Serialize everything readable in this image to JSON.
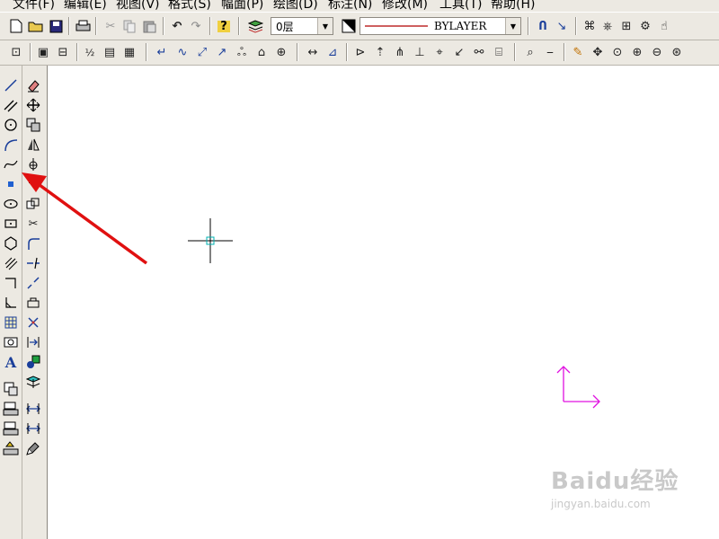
{
  "menu": [
    {
      "label": "文件(F)"
    },
    {
      "label": "编辑(E)"
    },
    {
      "label": "视图(V)"
    },
    {
      "label": "格式(S)"
    },
    {
      "label": "幅面(P)"
    },
    {
      "label": "绘图(D)"
    },
    {
      "label": "标注(N)"
    },
    {
      "label": "修改(M)"
    },
    {
      "label": "工具(T)"
    },
    {
      "label": "帮助(H)"
    }
  ],
  "toolbar": {
    "layer_value": "0层",
    "linetype_value": "BYLAYER",
    "linetype_color": "#b00000"
  },
  "annotations": {
    "arrow_color": "#e01010",
    "ucs_color": "#e010e0",
    "pickbox_color": "#00b0b0"
  },
  "watermark": {
    "main": "Baidu经验",
    "sub": "jingyan.baidu.com"
  }
}
